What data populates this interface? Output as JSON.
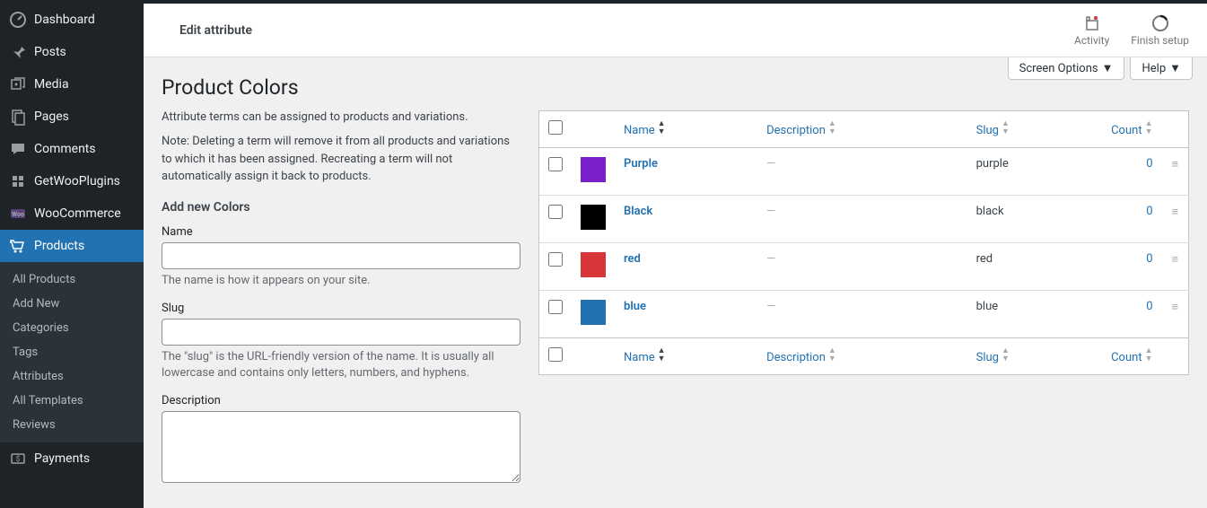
{
  "sidebar": {
    "items": [
      {
        "label": "Dashboard",
        "icon": "dashboard"
      },
      {
        "label": "Posts",
        "icon": "pin"
      },
      {
        "label": "Media",
        "icon": "media"
      },
      {
        "label": "Pages",
        "icon": "pages"
      },
      {
        "label": "Comments",
        "icon": "comments"
      },
      {
        "label": "GetWooPlugins",
        "icon": "plugins"
      },
      {
        "label": "WooCommerce",
        "icon": "woo"
      },
      {
        "label": "Products",
        "icon": "products",
        "active": true
      },
      {
        "label": "Payments",
        "icon": "payments"
      }
    ],
    "submenu": [
      "All Products",
      "Add New",
      "Categories",
      "Tags",
      "Attributes",
      "All Templates",
      "Reviews"
    ]
  },
  "header": {
    "title": "Edit attribute",
    "actions": [
      {
        "label": "Activity",
        "icon": "activity"
      },
      {
        "label": "Finish setup",
        "icon": "finish"
      }
    ]
  },
  "screen_tabs": {
    "options": "Screen Options",
    "help": "Help"
  },
  "page": {
    "title": "Product Colors",
    "intro": "Attribute terms can be assigned to products and variations.",
    "note": "Note: Deleting a term will remove it from all products and variations to which it has been assigned. Recreating a term will not automatically assign it back to products.",
    "form": {
      "heading": "Add new Colors",
      "name": {
        "label": "Name",
        "help": "The name is how it appears on your site."
      },
      "slug": {
        "label": "Slug",
        "help": "The \"slug\" is the URL-friendly version of the name. It is usually all lowercase and contains only letters, numbers, and hyphens."
      },
      "desc": {
        "label": "Description"
      }
    }
  },
  "table": {
    "columns": {
      "name": "Name",
      "desc": "Description",
      "slug": "Slug",
      "count": "Count"
    },
    "rows": [
      {
        "name": "Purple",
        "color": "#7a1fc9",
        "desc": "—",
        "slug": "purple",
        "count": "0"
      },
      {
        "name": "Black",
        "color": "#000000",
        "desc": "—",
        "slug": "black",
        "count": "0"
      },
      {
        "name": "red",
        "color": "#d63638",
        "desc": "—",
        "slug": "red",
        "count": "0"
      },
      {
        "name": "blue",
        "color": "#2271b1",
        "desc": "—",
        "slug": "blue",
        "count": "0"
      }
    ]
  }
}
